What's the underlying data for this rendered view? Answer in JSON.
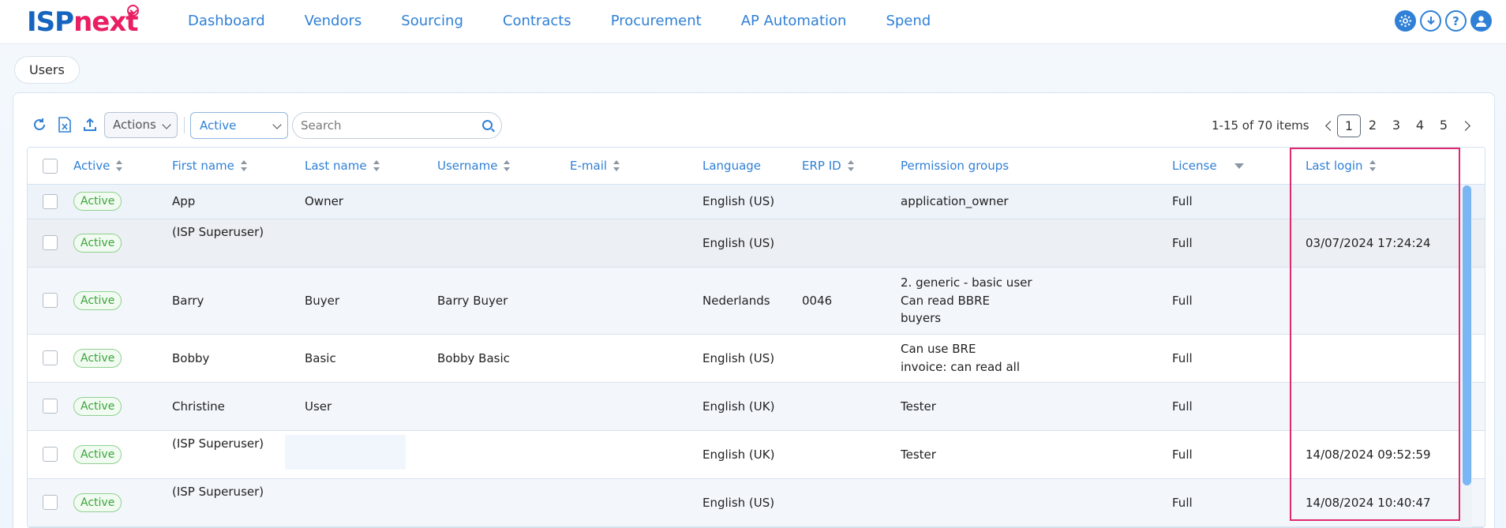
{
  "brand": {
    "part1": "ISP",
    "part2": "next"
  },
  "nav": [
    "Dashboard",
    "Vendors",
    "Sourcing",
    "Contracts",
    "Procurement",
    "AP Automation",
    "Spend"
  ],
  "top_icons": [
    "settings-icon",
    "download-icon",
    "help-icon",
    "user-icon"
  ],
  "breadcrumb": "Users",
  "toolbar": {
    "actions_label": "Actions",
    "status_filter": "Active",
    "search_placeholder": "Search",
    "pager_info": "1-15 of 70 items",
    "pages": [
      "1",
      "2",
      "3",
      "4",
      "5"
    ],
    "current_page": "1"
  },
  "columns": {
    "active": "Active",
    "first_name": "First name",
    "last_name": "Last name",
    "username": "Username",
    "email": "E-mail",
    "language": "Language",
    "erp_id": "ERP ID",
    "permission_groups": "Permission groups",
    "license": "License",
    "last_login": "Last login"
  },
  "rows": [
    {
      "status": "Active",
      "first": "App",
      "last": "Owner",
      "username": "",
      "email": "",
      "language": "English (US)",
      "erp": "",
      "perm1": "application_owner",
      "perm2": "",
      "perm3": "",
      "license": "Full",
      "login": ""
    },
    {
      "status": "Active",
      "first": "(ISP Superuser)",
      "last": "",
      "username": "",
      "email": "",
      "language": "English (US)",
      "erp": "",
      "perm1": "",
      "perm2": "",
      "perm3": "",
      "license": "Full",
      "login": "03/07/2024 17:24:24"
    },
    {
      "status": "Active",
      "first": "Barry",
      "last": "Buyer",
      "username": "Barry Buyer",
      "email": "",
      "language": "Nederlands",
      "erp": "0046",
      "perm1": "2. generic - basic user",
      "perm2": "Can read BBRE",
      "perm3": "buyers",
      "license": "Full",
      "login": ""
    },
    {
      "status": "Active",
      "first": "Bobby",
      "last": "Basic",
      "username": "Bobby Basic",
      "email": "",
      "language": "English (US)",
      "erp": "",
      "perm1": "Can use BRE",
      "perm2": "invoice: can read all",
      "perm3": "",
      "license": "Full",
      "login": ""
    },
    {
      "status": "Active",
      "first": "Christine",
      "last": "User",
      "username": "",
      "email": "",
      "language": "English (UK)",
      "erp": "",
      "perm1": "Tester",
      "perm2": "",
      "perm3": "",
      "license": "Full",
      "login": ""
    },
    {
      "status": "Active",
      "first": "(ISP Superuser)",
      "last": "",
      "username": "",
      "email": "",
      "language": "English (UK)",
      "erp": "",
      "perm1": "Tester",
      "perm2": "",
      "perm3": "",
      "license": "Full",
      "login": "14/08/2024 09:52:59"
    },
    {
      "status": "Active",
      "first": "(ISP Superuser)",
      "last": "",
      "username": "",
      "email": "",
      "language": "English (US)",
      "erp": "",
      "perm1": "",
      "perm2": "",
      "perm3": "",
      "license": "Full",
      "login": "14/08/2024 10:40:47"
    }
  ],
  "colors": {
    "accent": "#2f80d6",
    "brand_pink": "#e91e63",
    "highlight": "#e0296f",
    "badge_green": "#3aa53a"
  }
}
